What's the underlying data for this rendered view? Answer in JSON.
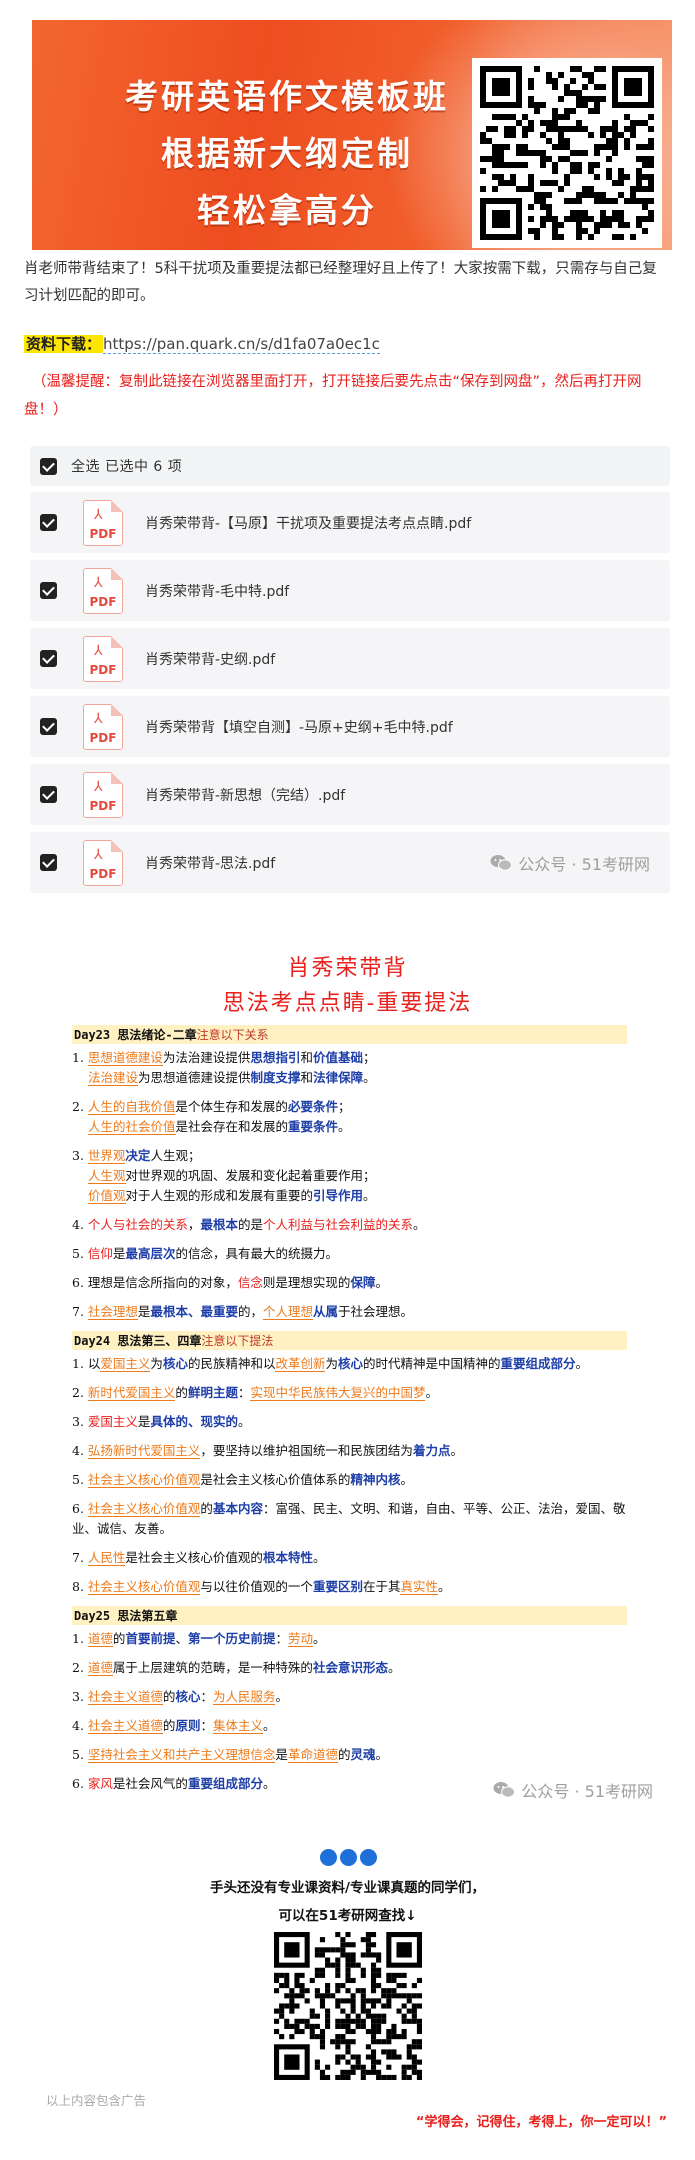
{
  "banner": {
    "line1": "考研英语作文模板班",
    "line2": "根据新大纲定制",
    "line3": "轻松拿高分"
  },
  "intro": "肖老师带背结束了！5科干扰项及重要提法都已经整理好且上传了！大家按需下载，只需存与自己复习计划匹配的即可。",
  "download": {
    "label": "资料下载：",
    "url": "https://pan.quark.cn/s/d1fa07a0ec1c"
  },
  "tip": "（温馨提醒：复制此链接在浏览器里面打开，打开链接后要先点击“保存到网盘”，然后再打开网盘！）",
  "file_list": {
    "select_all": "全选  已选中  6  项",
    "files": [
      "肖秀荣带背-【马原】干扰项及重要提法考点点睛.pdf",
      "肖秀荣带背-毛中特.pdf",
      "肖秀荣带背-史纲.pdf",
      "肖秀荣带背【填空自测】-马原+史纲+毛中特.pdf",
      "肖秀荣带背-新思想（完结）.pdf",
      "肖秀荣带背-思法.pdf"
    ],
    "pdf_tag": "PDF"
  },
  "watermark": "公众号 · 51考研网",
  "notes": {
    "title1": "肖秀荣带背",
    "title2": "思法考点点睛-重要提法",
    "day23": {
      "head": "Day23 思法绪论-二章",
      "sub": "注意以下关系"
    },
    "d23": {
      "i1a": "1. ",
      "i1b": "思想道德建设",
      "i1c": "为法治建设提供",
      "i1d": "思想指引",
      "i1e": "和",
      "i1f": "价值基础",
      "i1g": "；",
      "i1h": "法治建设",
      "i1i": "为思想道德建设提供",
      "i1j": "制度支撑",
      "i1k": "和",
      "i1l": "法律保障",
      "i1m": "。",
      "i2a": "2. ",
      "i2b": "人生的自我价值",
      "i2c": "是个体生存和发展的",
      "i2d": "必要条件",
      "i2e": "；",
      "i2f": "人生的社会价值",
      "i2g": "是社会存在和发展的",
      "i2h": "重要条件",
      "i2i": "。",
      "i3a": "3. ",
      "i3b": "世界观",
      "i3c": "决定",
      "i3d": "人生观；",
      "i3e": "人生观",
      "i3f": "对世界观的巩固、发展和变化起着重要作用；",
      "i3g": "价值观",
      "i3h": "对于人生观的形成和发展有重要的",
      "i3i": "引导作用",
      "i3j": "。",
      "i4a": "4. ",
      "i4b": "个人与社会的关系",
      "i4c": "，",
      "i4d": "最根本",
      "i4e": "的是",
      "i4f": "个人利益与社会利益的关系",
      "i4g": "。",
      "i5a": "5. ",
      "i5b": "信仰",
      "i5c": "是",
      "i5d": "最高层次",
      "i5e": "的信念，具有最大的统摄力。",
      "i6a": "6. 理想是信念所指向的对象，",
      "i6b": "信念",
      "i6c": "则是理想实现的",
      "i6d": "保障",
      "i6e": "。",
      "i7a": "7. ",
      "i7b": "社会理想",
      "i7c": "是",
      "i7d": "最根本、最重要",
      "i7e": "的，",
      "i7f": "个人理想",
      "i7g": "从属",
      "i7h": "于社会理想。"
    },
    "day24": {
      "head": "Day24 思法第三、四章",
      "sub": "注意以下提法"
    },
    "d24": {
      "i1a": "1. 以",
      "i1b": "爱国主义",
      "i1c": "为",
      "i1d": "核心",
      "i1e": "的民族精神和以",
      "i1f": "改革创新",
      "i1g": "为",
      "i1h": "核心",
      "i1i": "的时代精神是中国精神的",
      "i1j": "重要组成部分",
      "i1k": "。",
      "i2a": "2. ",
      "i2b": "新时代爱国主义",
      "i2c": "的",
      "i2d": "鲜明主题",
      "i2e": "：",
      "i2f": "实现中华民族伟大复兴的中国梦",
      "i2g": "。",
      "i3a": "3. ",
      "i3b": "爱国主义",
      "i3c": "是",
      "i3d": "具体的、现实的",
      "i3e": "。",
      "i4a": "4. ",
      "i4b": "弘扬新时代爱国主义",
      "i4c": "，要坚持以维护祖国统一和民族团结为",
      "i4d": "着力点",
      "i4e": "。",
      "i5a": "5. ",
      "i5b": "社会主义核心价值观",
      "i5c": "是社会主义核心价值体系的",
      "i5d": "精神内核",
      "i5e": "。",
      "i6a": "6. ",
      "i6b": "社会主义核心价值观",
      "i6c": "的",
      "i6d": "基本内容",
      "i6e": "：富强、民主、文明、和谐，自由、平等、公正、法治，爱国、敬业、诚信、友善。",
      "i7a": "7. ",
      "i7b": "人民性",
      "i7c": "是社会主义核心价值观的",
      "i7d": "根本特性",
      "i7e": "。",
      "i8a": "8. ",
      "i8b": "社会主义核心价值观",
      "i8c": "与以往价值观的一个",
      "i8d": "重要区别",
      "i8e": "在于其",
      "i8f": "真实性",
      "i8g": "。"
    },
    "day25": {
      "head": "Day25 思法第五章",
      "sub": ""
    },
    "d25": {
      "i1a": "1. ",
      "i1b": "道德",
      "i1c": "的",
      "i1d": "首要前提",
      "i1e": "、",
      "i1f": "第一个历史前提",
      "i1g": "：",
      "i1h": "劳动",
      "i1i": "。",
      "i2a": "2. ",
      "i2b": "道德",
      "i2c": "属于上层建筑的范畴，是一种特殊的",
      "i2d": "社会意识形态",
      "i2e": "。",
      "i3a": "3. ",
      "i3b": "社会主义道德",
      "i3c": "的",
      "i3d": "核心",
      "i3e": "：",
      "i3f": "为人民服务",
      "i3g": "。",
      "i4a": "4. ",
      "i4b": "社会主义道德",
      "i4c": "的",
      "i4d": "原则",
      "i4e": "：",
      "i4f": "集体主义",
      "i4g": "。",
      "i5a": "5. ",
      "i5b": "坚持社会主义和共产主义理想信念",
      "i5c": "是",
      "i5d": "革命道德",
      "i5e": "的",
      "i5f": "灵魂",
      "i5g": "。",
      "i6a": "6. ",
      "i6b": "家风",
      "i6c": "是社会风气的",
      "i6d": "重要组成部分",
      "i6e": "。"
    }
  },
  "cta": {
    "line1": "手头还没有专业课资料/专业课真题的同学们，",
    "line2": "可以在51考研网查找↓"
  },
  "ad_note": "以上内容包含广告",
  "slogan": "“学得会，记得住，考得上，你一定可以！”",
  "colors": {
    "accent_red": "#e8211d",
    "orange": "#ef7a1a",
    "blue": "#1f3fa8",
    "banner": "#ee4d20"
  },
  "icons": [
    "checkbox-checked-icon",
    "pdf-file-icon",
    "wechat-icon",
    "qr-code"
  ]
}
